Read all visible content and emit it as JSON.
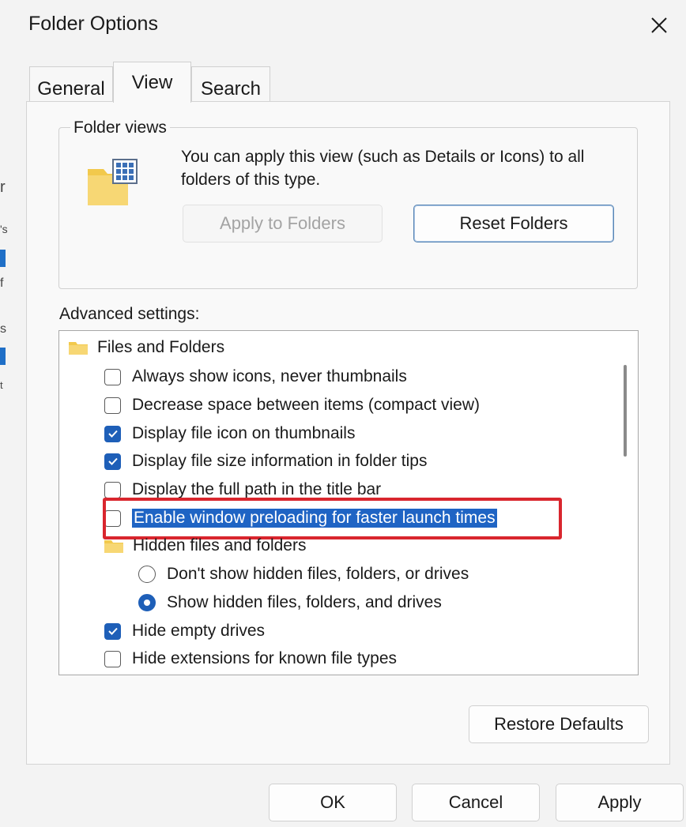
{
  "background": {
    "fragments": [
      "r",
      "'s",
      "f",
      "s",
      "t"
    ]
  },
  "dialog": {
    "title": "Folder Options"
  },
  "tabs": [
    {
      "label": "General",
      "active": false
    },
    {
      "label": "View",
      "active": true
    },
    {
      "label": "Search",
      "active": false
    }
  ],
  "folder_views": {
    "label": "Folder views",
    "description": "You can apply this view (such as Details or Icons) to all folders of this type.",
    "apply_button": "Apply to Folders",
    "reset_button": "Reset Folders"
  },
  "advanced": {
    "label": "Advanced settings:",
    "items": [
      {
        "type": "folder",
        "label": "Files and Folders"
      },
      {
        "type": "checkbox",
        "label": "Always show icons, never thumbnails",
        "checked": false
      },
      {
        "type": "checkbox",
        "label": "Decrease space between items (compact view)",
        "checked": false
      },
      {
        "type": "checkbox",
        "label": "Display file icon on thumbnails",
        "checked": true
      },
      {
        "type": "checkbox",
        "label": "Display file size information in folder tips",
        "checked": true
      },
      {
        "type": "checkbox",
        "label": "Display the full path in the title bar",
        "checked": false
      },
      {
        "type": "checkbox",
        "label": "Enable window preloading for faster launch times",
        "checked": false,
        "selected": true
      },
      {
        "type": "folder",
        "label": "Hidden files and folders"
      },
      {
        "type": "radio",
        "label": "Don't show hidden files, folders, or drives",
        "checked": false
      },
      {
        "type": "radio",
        "label": "Show hidden files, folders, and drives",
        "checked": true
      },
      {
        "type": "checkbox",
        "label": "Hide empty drives",
        "checked": true
      },
      {
        "type": "checkbox",
        "label": "Hide extensions for known file types",
        "checked": false
      }
    ]
  },
  "buttons": {
    "restore_defaults": "Restore Defaults",
    "ok": "OK",
    "cancel": "Cancel",
    "apply": "Apply"
  },
  "colors": {
    "accent": "#1e5fb8",
    "highlight_border": "#d9262e",
    "dialog_bg": "#f3f3f3"
  }
}
